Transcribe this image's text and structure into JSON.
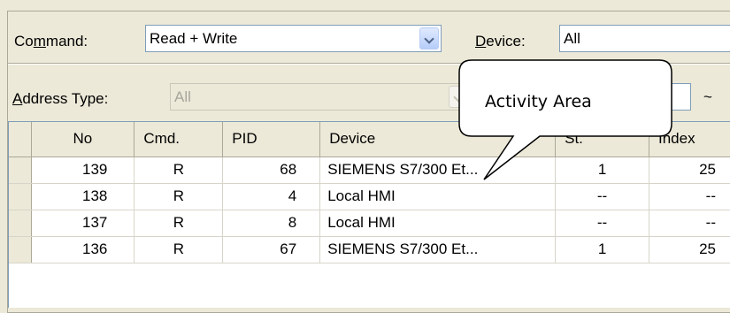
{
  "filters": {
    "command_label_pre": "Co",
    "command_label_key": "m",
    "command_label_post": "mand:",
    "command_value": "Read + Write",
    "device_label_key": "D",
    "device_label_post": "evice:",
    "device_value": "All",
    "address_label_key": "A",
    "address_label_post": "ddress Type:",
    "address_value": "All",
    "range_separator": "~"
  },
  "callout": {
    "text": "Activity Area"
  },
  "table": {
    "columns": [
      "No",
      "Cmd.",
      "PID",
      "Device",
      "St.",
      "Index"
    ],
    "rows": [
      {
        "no": "139",
        "cmd": "R",
        "pid": "68",
        "device": "SIEMENS S7/300 Et...",
        "st": "1",
        "index": "25"
      },
      {
        "no": "138",
        "cmd": "R",
        "pid": "4",
        "device": "Local HMI",
        "st": "--",
        "index": "--"
      },
      {
        "no": "137",
        "cmd": "R",
        "pid": "8",
        "device": "Local HMI",
        "st": "--",
        "index": "--"
      },
      {
        "no": "136",
        "cmd": "R",
        "pid": "67",
        "device": "SIEMENS S7/300 Et...",
        "st": "1",
        "index": "25"
      }
    ]
  }
}
